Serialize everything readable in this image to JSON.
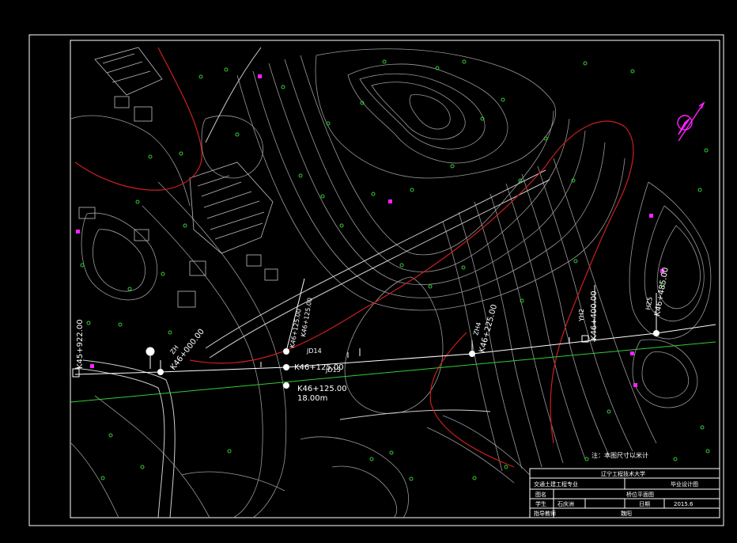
{
  "drawing": {
    "stations": {
      "start": "K45+922.00",
      "zh": "ZH",
      "k46_000": "K46+000.00",
      "k46_125a": "K46+125.00",
      "k46_125b": "K46+125.00",
      "jd14": "JD14",
      "k46_125c": "K46+125.00",
      "jd15": "JD15",
      "k46_125d": "K46+125.00",
      "span": "18.00m",
      "hz": "ZH4",
      "k46_225": "K46+225.00",
      "yh": "YH2",
      "k46_400": "K46+400.00",
      "hz2": "HZ5",
      "k46_485": "K46+485.00"
    },
    "note": "注：本图尺寸以米计"
  },
  "title_block": {
    "university": "辽宁工程技术大学",
    "major": "交通土建工程专业",
    "project_type": "毕业设计图",
    "drawing_name_label": "图名",
    "drawing_name": "桥位平面图",
    "student_label": "学生",
    "student": "石庆洲",
    "date_label": "日期",
    "date": "2015.6",
    "advisor_label": "指导教师",
    "advisor": "魏阳"
  },
  "colors": {
    "background": "#000000",
    "contour": "#9a9a9a",
    "road_red": "#cc1f1f",
    "survey_green": "#33cc33",
    "north_arrow": "#ff22ff",
    "frame": "#ffffff"
  }
}
